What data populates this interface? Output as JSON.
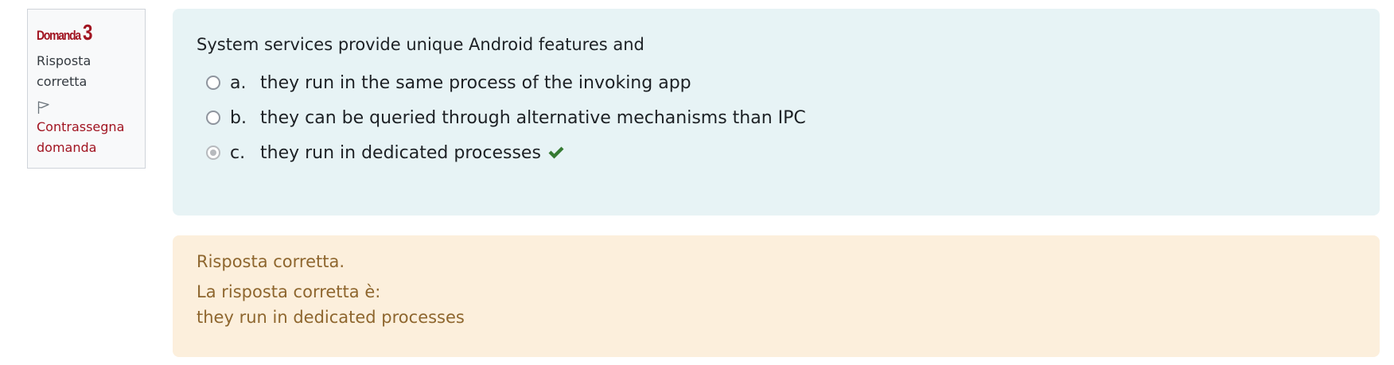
{
  "question_info": {
    "label": "Domanda",
    "number": "3",
    "state": "Risposta corretta",
    "flag_label": "Contrassegna domanda"
  },
  "question": {
    "text": "System services provide unique Android features and",
    "options": [
      {
        "letter": "a.",
        "text": "they run in the same process of the invoking app",
        "checked": false
      },
      {
        "letter": "b.",
        "text": "they can be queried through alternative mechanisms than IPC",
        "checked": false
      },
      {
        "letter": "c.",
        "text": "they run in dedicated processes",
        "checked": true,
        "correct": true
      }
    ]
  },
  "feedback": {
    "result": "Risposta corretta.",
    "right_answer_label": "La risposta corretta è:",
    "right_answer": "they run in dedicated processes"
  },
  "colors": {
    "accent": "#a11421",
    "content_bg": "#e7f3f5",
    "feedback_bg": "#fcefdc",
    "feedback_text": "#8e662e",
    "correct_check": "#357a32"
  },
  "icons": {
    "flag": "flag-icon",
    "correct": "check-icon"
  }
}
